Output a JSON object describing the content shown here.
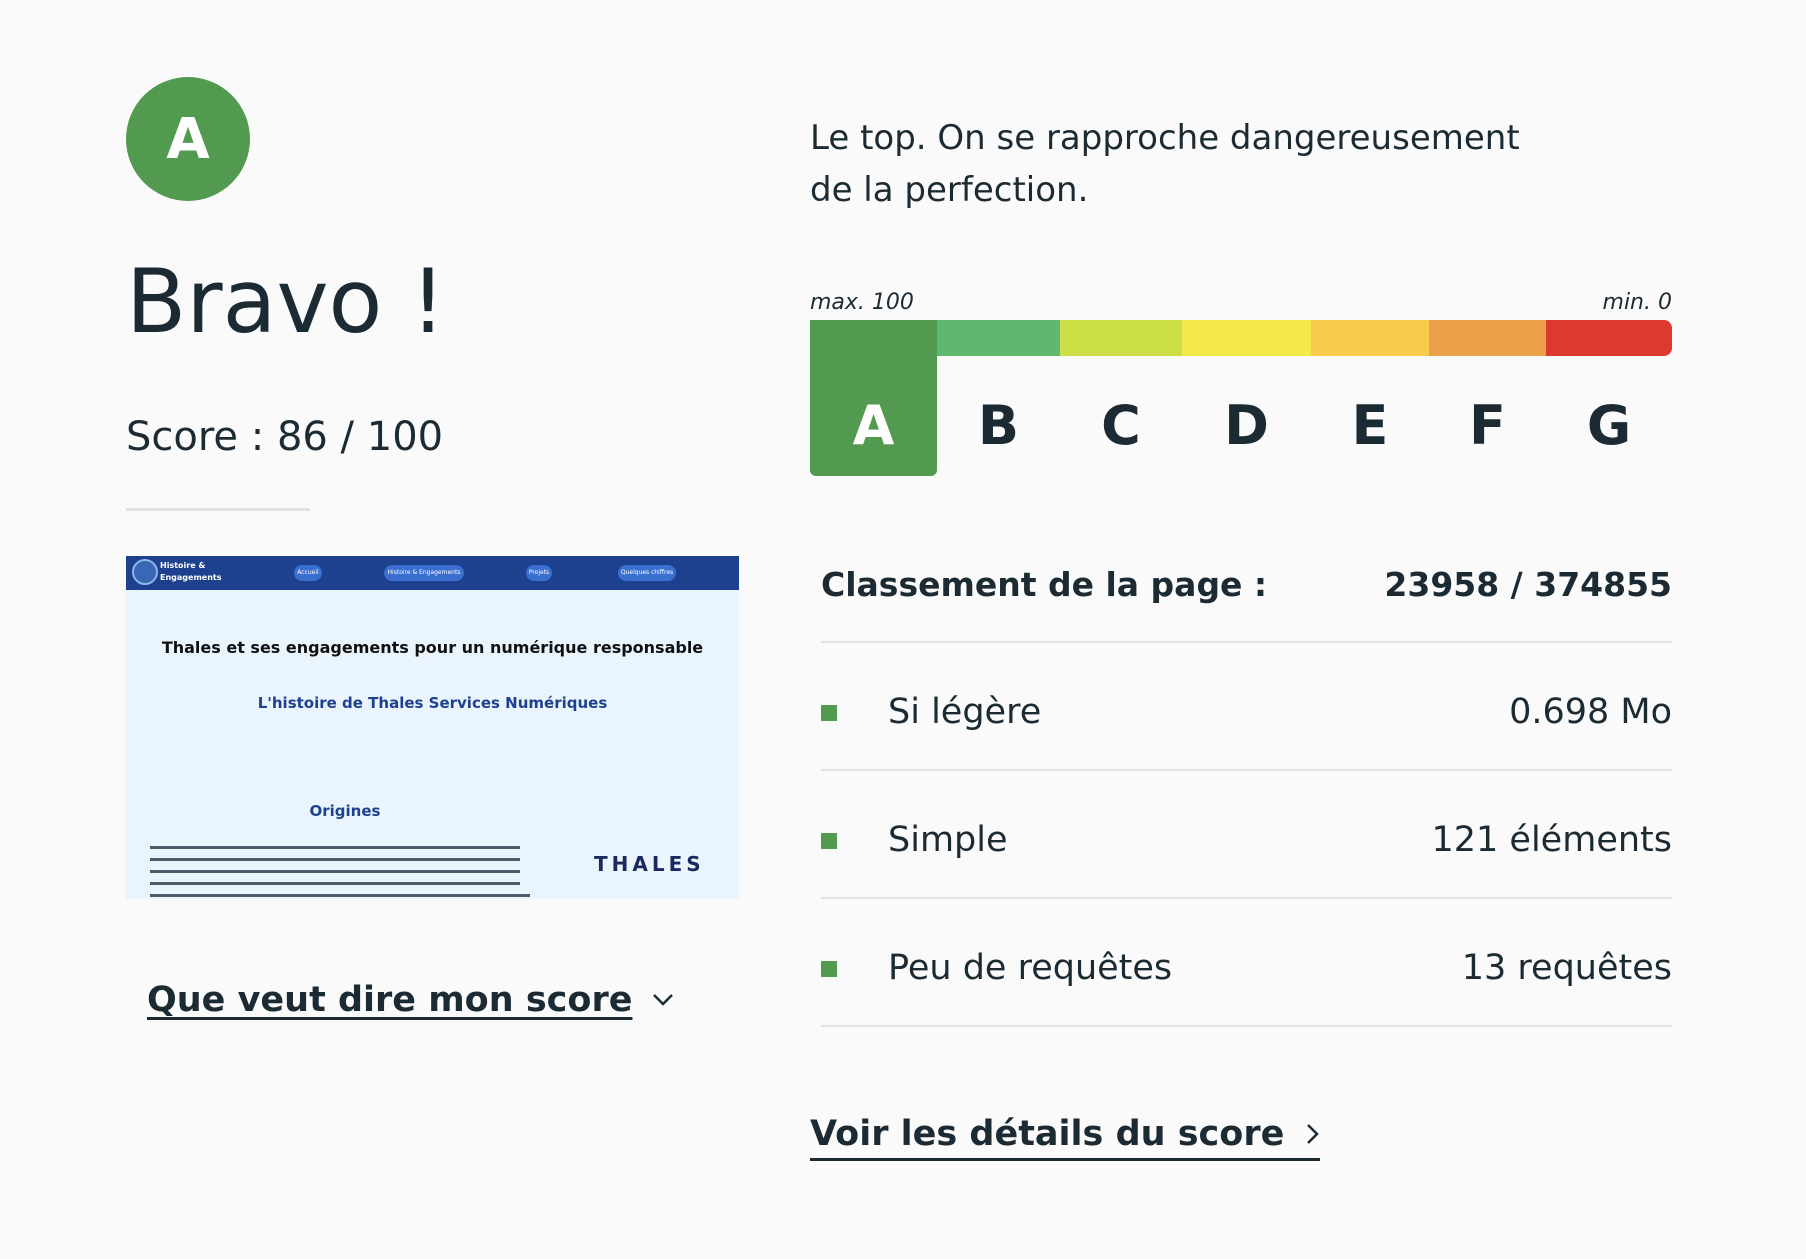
{
  "grade": {
    "letter": "A",
    "color": "#519a4f"
  },
  "heading": "Bravo !",
  "score_text": "Score : 86 / 100",
  "score": {
    "value": 86,
    "max": 100
  },
  "description": "Le top. On se rapproche dangereusement de la perfection.",
  "scale": {
    "max_label": "max. 100",
    "min_label": "min. 0",
    "selected": "A",
    "grades": [
      {
        "letter": "A",
        "color": "#519a4f"
      },
      {
        "letter": "B",
        "color": "#5eb96f"
      },
      {
        "letter": "C",
        "color": "#cddf46"
      },
      {
        "letter": "D",
        "color": "#f3e94d"
      },
      {
        "letter": "E",
        "color": "#f7cd4b"
      },
      {
        "letter": "F",
        "color": "#eba147"
      },
      {
        "letter": "G",
        "color": "#dc3a2e"
      }
    ]
  },
  "thumbnail": {
    "brand": "Histoire & Engagements",
    "nav": [
      "Accueil",
      "Histoire & Engagements",
      "Projets",
      "Quelques chiffres"
    ],
    "heading": "Thales et ses engagements pour un numérique responsable",
    "subheading": "L'histoire de Thales Services Numériques",
    "section": "Origines",
    "logo": "THALES"
  },
  "links": {
    "explain": "Que veut dire mon score",
    "details": "Voir les détails du score"
  },
  "ranking": {
    "label": "Classement de la page :",
    "value": "23958 / 374855"
  },
  "metrics": [
    {
      "label": "Si légère",
      "value": "0.698 Mo"
    },
    {
      "label": "Simple",
      "value": "121 éléments"
    },
    {
      "label": "Peu de requêtes",
      "value": "13 requêtes"
    }
  ]
}
